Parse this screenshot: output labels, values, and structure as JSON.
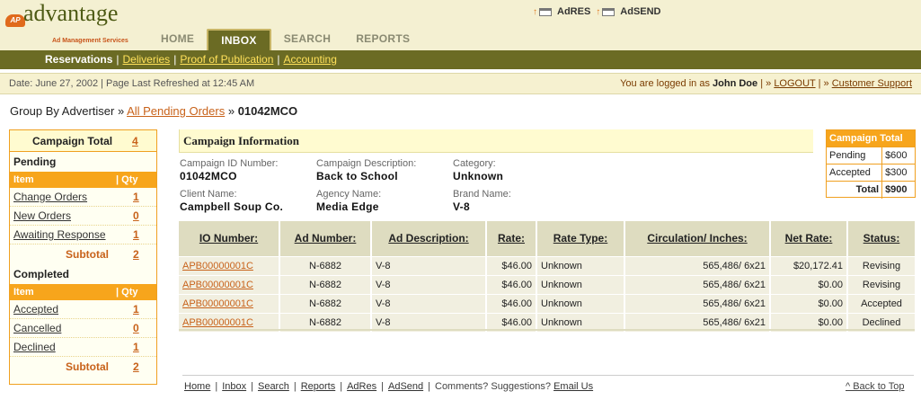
{
  "logo": {
    "badge": "AP",
    "brand": "advantage",
    "tagline": "Ad Management Services"
  },
  "top_links": [
    {
      "label": "AdRES"
    },
    {
      "label": "AdSEND"
    }
  ],
  "tabs": [
    {
      "label": "HOME",
      "active": false
    },
    {
      "label": "INBOX",
      "active": true
    },
    {
      "label": "SEARCH",
      "active": false
    },
    {
      "label": "REPORTS",
      "active": false
    }
  ],
  "subnav": {
    "current": "Reservations",
    "links": [
      "Deliveries",
      "Proof of Publication",
      "Accounting"
    ]
  },
  "status": {
    "date": "Date: June 27, 2002 | Page Last Refreshed at 12:45 AM",
    "logged_prefix": "You are logged in as",
    "user": "John Doe",
    "logout": "LOGOUT",
    "support": "Customer Support"
  },
  "breadcrumb": {
    "prefix": "Group By Advertiser »",
    "link": "All Pending Orders",
    "sep": "»",
    "current": "01042MCO"
  },
  "left_panel": {
    "title": "Campaign Total",
    "total": "4",
    "pending_title": "Pending",
    "completed_title": "Completed",
    "item_header": "Item",
    "qty_header": "| Qty",
    "pending_items": [
      {
        "label": "Change Orders",
        "qty": "1"
      },
      {
        "label": "New Orders",
        "qty": "0"
      },
      {
        "label": "Awaiting Response",
        "qty": "1"
      }
    ],
    "pending_subtotal_label": "Subtotal",
    "pending_subtotal": "2",
    "completed_items": [
      {
        "label": "Accepted",
        "qty": "1"
      },
      {
        "label": "Cancelled",
        "qty": "0"
      },
      {
        "label": "Declined",
        "qty": "1"
      }
    ],
    "completed_subtotal_label": "Subtotal",
    "completed_subtotal": "2"
  },
  "campaign": {
    "title": "Campaign Information",
    "id_label": "Campaign ID Number:",
    "id_value": "01042MCO",
    "desc_label": "Campaign Description:",
    "desc_value": "Back to School",
    "cat_label": "Category:",
    "cat_value": "Unknown",
    "client_label": "Client Name:",
    "client_value": "Campbell Soup Co.",
    "agency_label": "Agency Name:",
    "agency_value": "Media Edge",
    "brand_label": "Brand Name:",
    "brand_value": "V-8"
  },
  "campaign_total_box": {
    "title": "Campaign Total",
    "rows": [
      {
        "label": "Pending",
        "value": "$600"
      },
      {
        "label": "Accepted",
        "value": "$300"
      }
    ],
    "total_label": "Total",
    "total_value": "$900"
  },
  "orders": {
    "headers": [
      "IO Number:",
      "Ad Number:",
      "Ad Description:",
      "Rate:",
      "Rate Type:",
      "Circulation/ Inches:",
      "Net Rate:",
      "Status:"
    ],
    "rows": [
      [
        "APB00000001C",
        "N-6882",
        "V-8",
        "$46.00",
        "Unknown",
        "565,486/ 6x21",
        "$20,172.41",
        "Revising"
      ],
      [
        "APB00000001C",
        "N-6882",
        "V-8",
        "$46.00",
        "Unknown",
        "565,486/ 6x21",
        "$0.00",
        "Revising"
      ],
      [
        "APB00000001C",
        "N-6882",
        "V-8",
        "$46.00",
        "Unknown",
        "565,486/ 6x21",
        "$0.00",
        "Accepted"
      ],
      [
        "APB00000001C",
        "N-6882",
        "V-8",
        "$46.00",
        "Unknown",
        "565,486/ 6x21",
        "$0.00",
        "Declined"
      ]
    ]
  },
  "footer": {
    "links": [
      "Home",
      "Inbox",
      "Search",
      "Reports",
      "AdRes",
      "AdSend"
    ],
    "comments": "Comments? Suggestions?",
    "email": "Email Us",
    "back_to_top": "^ Back to Top"
  },
  "colors": {
    "olive": "#6b6b24",
    "orange": "#f7a51c",
    "link_orange": "#c8621a",
    "cream": "#f4f0d2"
  }
}
